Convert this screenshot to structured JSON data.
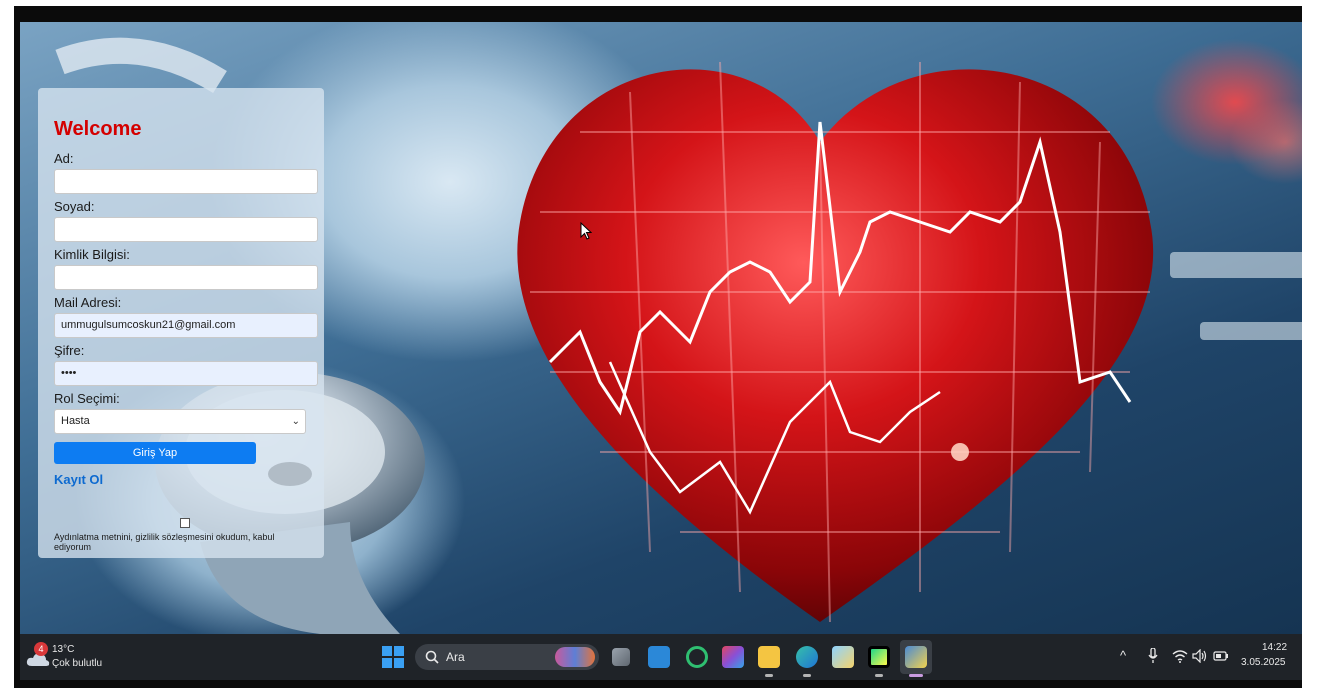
{
  "login": {
    "title": "Welcome",
    "first_name_label": "Ad:",
    "first_name_value": "",
    "last_name_label": "Soyad:",
    "last_name_value": "",
    "id_label": "Kimlik Bilgisi:",
    "id_value": "",
    "email_label": "Mail Adresi:",
    "email_value": "ummugulsumcoskun21@gmail.com",
    "password_label": "Şifre:",
    "password_value": "••••",
    "role_label": "Rol Seçimi:",
    "role_selected": "Hasta",
    "login_button": "Giriş Yap",
    "register_link": "Kayıt Ol",
    "terms_text": "Aydınlatma metnini, gizlilik sözleşmesini okudum, kabul ediyorum"
  },
  "taskbar": {
    "weather_badge": "4",
    "weather_temp": "13°C",
    "weather_desc": "Çok bulutlu",
    "search_placeholder": "Ara",
    "time": "14:22",
    "date": "3.05.2025"
  },
  "colors": {
    "accent_button": "#0d7cf2",
    "welcome_red": "#d40000",
    "link_blue": "#0d6ad0",
    "taskbar_bg": "#1f2328"
  },
  "icons": {
    "start": "windows-start-icon",
    "search": "search-icon",
    "task_view": "task-view-icon",
    "store": "store-icon",
    "copilot": "copilot-icon",
    "explorer": "file-explorer-icon",
    "edge": "edge-browser-icon",
    "notepad": "notepad-icon",
    "pycharm": "pycharm-icon",
    "wifi": "wifi-icon",
    "volume": "volume-icon",
    "battery": "battery-icon",
    "mic": "microphone-icon",
    "chevron": "chevron-up-icon"
  }
}
